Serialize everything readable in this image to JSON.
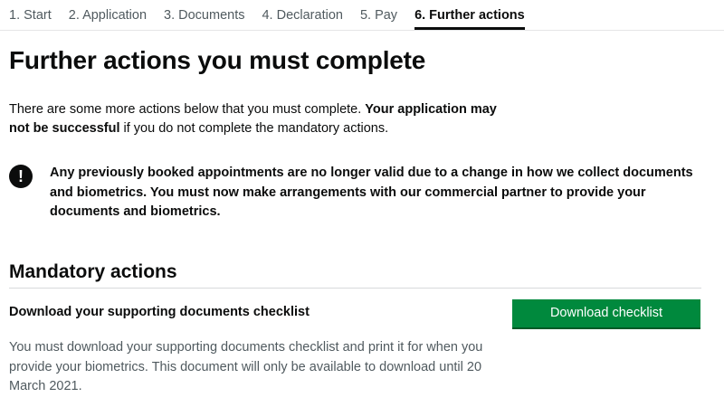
{
  "steps": [
    {
      "label": "1. Start",
      "active": false
    },
    {
      "label": "2. Application",
      "active": false
    },
    {
      "label": "3. Documents",
      "active": false
    },
    {
      "label": "4. Declaration",
      "active": false
    },
    {
      "label": "5. Pay",
      "active": false
    },
    {
      "label": "6. Further actions",
      "active": true
    }
  ],
  "page": {
    "title": "Further actions you must complete",
    "intro_text": "There are some more actions below that you must complete. ",
    "intro_bold": "Your application may not be successful",
    "intro_tail": " if you do not complete the mandatory actions."
  },
  "warning": {
    "icon": "!",
    "text": "Any previously booked appointments are no longer valid due to a change in how we collect documents and biometrics. You must now make arrangements with our commercial partner to provide your documents and biometrics."
  },
  "mandatory": {
    "heading": "Mandatory actions",
    "actions": [
      {
        "title": "Download your supporting documents checklist",
        "button_label": "Download checklist",
        "description": "You must download your supporting documents checklist and print it for when you provide your biometrics. This document will only be available to download until 20 March 2021."
      }
    ]
  }
}
